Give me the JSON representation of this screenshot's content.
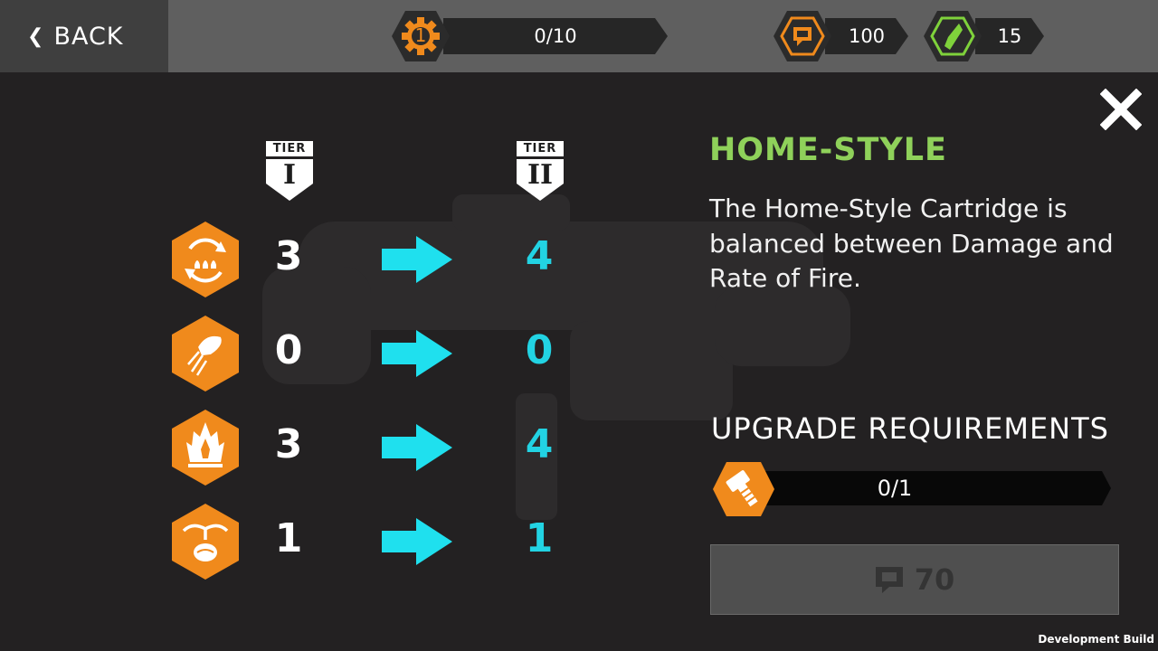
{
  "topbar": {
    "back_label": "BACK",
    "level": "1",
    "progress_text": "0/10",
    "currency_1_amount": "100",
    "currency_2_amount": "15"
  },
  "tiers": {
    "current_label": "TIER",
    "current_numeral": "I",
    "next_label": "TIER",
    "next_numeral": "II"
  },
  "stats": [
    {
      "icon": "ammo-reload-icon",
      "current": "3",
      "next": "4"
    },
    {
      "icon": "bullet-speed-icon",
      "current": "0",
      "next": "0"
    },
    {
      "icon": "fire-damage-icon",
      "current": "3",
      "next": "4"
    },
    {
      "icon": "plant-seed-icon",
      "current": "1",
      "next": "1"
    }
  ],
  "item": {
    "title": "HOME-STYLE",
    "description": "The Home-Style Cartridge is balanced between Damage and Rate of Fire."
  },
  "requirements": {
    "title": "UPGRADE REQUIREMENTS",
    "progress_text": "0/1"
  },
  "buy": {
    "cost": "70"
  },
  "footer": {
    "build_label": "Development Build"
  },
  "colors": {
    "accent_orange": "#f08a1c",
    "title_green": "#8fd15a",
    "upgrade_cyan": "#22d3e3",
    "gem_green": "#7fd23b"
  }
}
